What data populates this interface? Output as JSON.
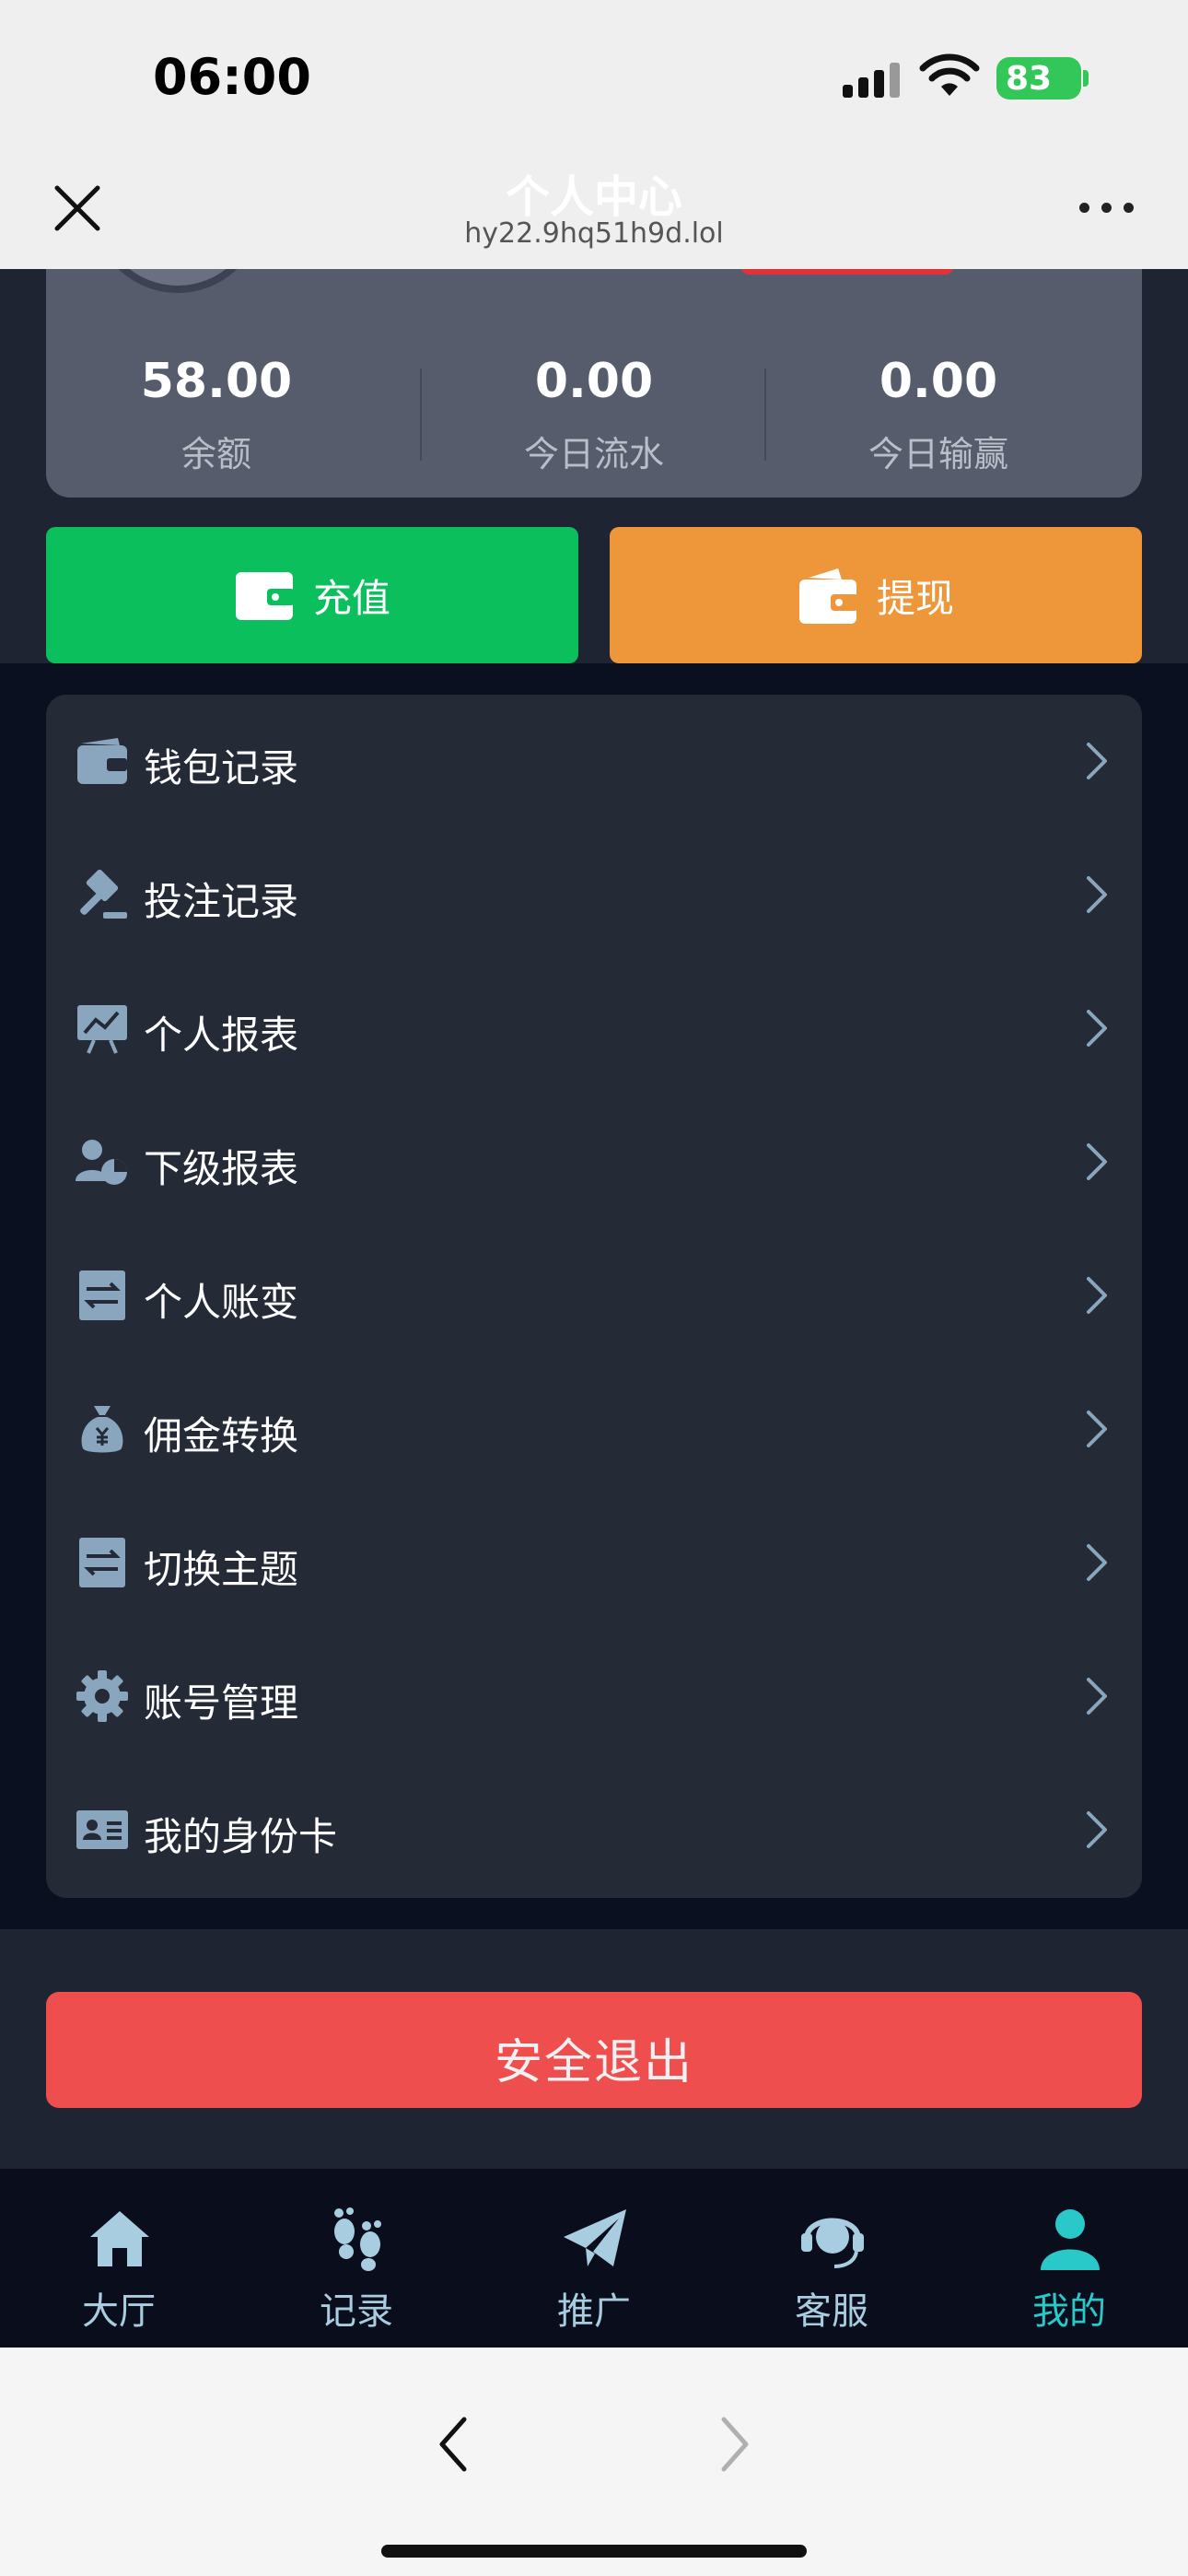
{
  "status_bar": {
    "time": "06:00",
    "battery": "83"
  },
  "title_bar": {
    "title": "个人中心",
    "url": "hy22.9hq51h9d.lol"
  },
  "profile": {
    "stats": [
      {
        "value": "58.00",
        "label": "余额"
      },
      {
        "value": "0.00",
        "label": "今日流水"
      },
      {
        "value": "0.00",
        "label": "今日输赢"
      }
    ]
  },
  "actions": {
    "recharge": {
      "label": "充值",
      "color": "#0bbf5d"
    },
    "withdraw": {
      "label": "提现",
      "color": "#ee963a"
    }
  },
  "menu": {
    "items": [
      {
        "label": "钱包记录",
        "icon": "wallet-icon"
      },
      {
        "label": "投注记录",
        "icon": "gavel-icon"
      },
      {
        "label": "个人报表",
        "icon": "chart-board-icon"
      },
      {
        "label": "下级报表",
        "icon": "user-chart-icon"
      },
      {
        "label": "个人账变",
        "icon": "transfer-receipt-icon"
      },
      {
        "label": "佣金转换",
        "icon": "money-bag-icon"
      },
      {
        "label": "切换主题",
        "icon": "switch-receipt-icon"
      },
      {
        "label": "账号管理",
        "icon": "gear-icon"
      },
      {
        "label": "我的身份卡",
        "icon": "id-card-icon"
      }
    ]
  },
  "logout": {
    "label": "安全退出",
    "color": "#ef4e4e"
  },
  "tabbar": {
    "active_color": "#29c9c9",
    "items": [
      {
        "label": "大厅",
        "icon": "home-icon"
      },
      {
        "label": "记录",
        "icon": "footprints-icon"
      },
      {
        "label": "推广",
        "icon": "paper-plane-icon"
      },
      {
        "label": "客服",
        "icon": "headset-icon"
      },
      {
        "label": "我的",
        "icon": "user-icon",
        "active": true
      }
    ]
  }
}
